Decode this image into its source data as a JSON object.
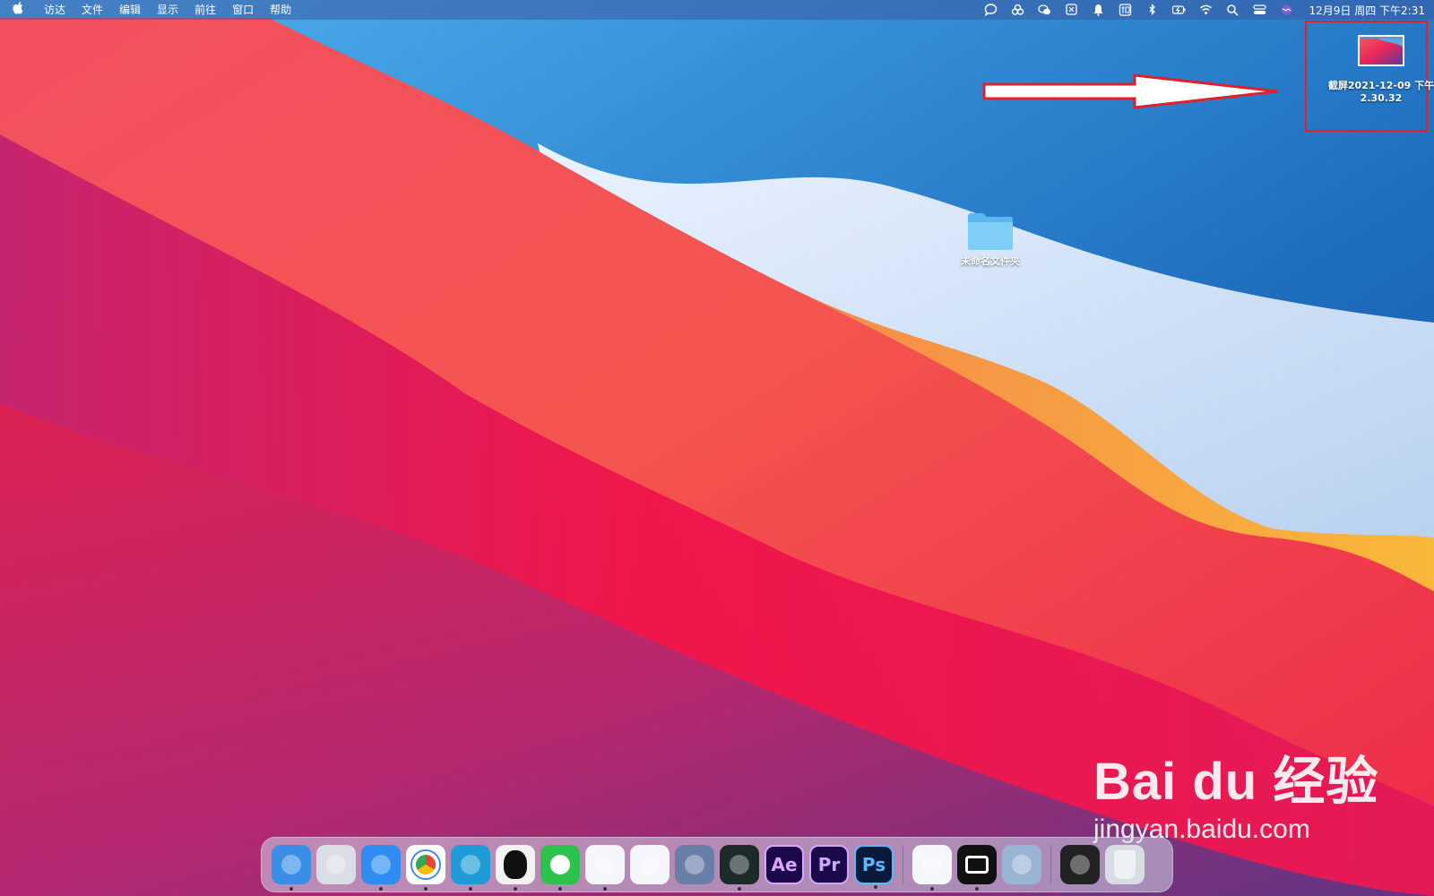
{
  "menubar": {
    "apple_icon": "apple-logo",
    "items": [
      "访达",
      "文件",
      "编辑",
      "显示",
      "前往",
      "窗口",
      "帮助"
    ],
    "status_icons": [
      "message-icon",
      "baidu-netdisk-icon",
      "wechat-icon",
      "grid-icon",
      "bell-icon",
      "input-method-icon",
      "bluetooth-icon",
      "battery-icon",
      "wifi-icon",
      "search-icon",
      "control-center-icon",
      "siri-icon"
    ],
    "clock": "12月9日 周四 下午2:31"
  },
  "desktop": {
    "screenshot_file": {
      "label": "截屏2021-12-09 下午2.30.32"
    },
    "folder": {
      "label": "未命名文件夹"
    },
    "highlight_color": "#e0202a"
  },
  "dock": {
    "apps": [
      {
        "name": "Finder",
        "icon": "finder-icon",
        "color": "#3a8ee6",
        "text": "",
        "running": true
      },
      {
        "name": "Launchpad",
        "icon": "launchpad-icon",
        "color": "#d9dde6",
        "text": "",
        "running": false
      },
      {
        "name": "Safari",
        "icon": "safari-icon",
        "color": "#2f8cf0",
        "text": "",
        "running": true
      },
      {
        "name": "Chrome",
        "icon": "chrome-icon",
        "color": "#ffffff",
        "text": "",
        "running": true
      },
      {
        "name": "Edge",
        "icon": "edge-icon",
        "color": "#1f9bd8",
        "text": "",
        "running": true
      },
      {
        "name": "QQ",
        "icon": "qq-icon",
        "color": "#f2f2f2",
        "text": "",
        "running": true
      },
      {
        "name": "WeChat",
        "icon": "wechat-icon",
        "color": "#2dc14e",
        "text": "",
        "running": true
      },
      {
        "name": "Messages",
        "icon": "message-icon",
        "color": "#f4f6fb",
        "text": "",
        "running": true
      },
      {
        "name": "Send",
        "icon": "paper-plane-icon",
        "color": "#f4f6fb",
        "text": "",
        "running": false
      },
      {
        "name": "Parallels",
        "icon": "parallels-icon",
        "color": "#6a7fa8",
        "text": "",
        "running": false
      },
      {
        "name": "Filmora",
        "icon": "filmora-icon",
        "color": "#1d2a2a",
        "text": "",
        "running": true
      },
      {
        "name": "After Effects",
        "icon": "after-effects-icon",
        "color": "#1b0a4a",
        "text": "Ae",
        "running": false
      },
      {
        "name": "Premiere Pro",
        "icon": "premiere-icon",
        "color": "#1b0a4a",
        "text": "Pr",
        "running": false
      },
      {
        "name": "Photoshop",
        "icon": "photoshop-icon",
        "color": "#0a1a3c",
        "text": "Ps",
        "running": true
      },
      {
        "name": "Baidu Netdisk",
        "icon": "baidu-netdisk-icon",
        "color": "#f4f6fb",
        "text": "",
        "running": true
      },
      {
        "name": "CapCut",
        "icon": "capcut-icon",
        "color": "#111111",
        "text": "",
        "running": true
      },
      {
        "name": "Preview",
        "icon": "preview-icon",
        "color": "#9ab4d4",
        "text": "",
        "running": false
      },
      {
        "name": "Screen",
        "icon": "screen-recorder-icon",
        "color": "#222222",
        "text": "",
        "running": false
      },
      {
        "name": "Trash",
        "icon": "trash-icon",
        "color": "#d8dde4",
        "text": "",
        "running": false
      }
    ]
  },
  "watermark": {
    "brand": "Bai du 经验",
    "url": "jingyan.baidu.com"
  }
}
